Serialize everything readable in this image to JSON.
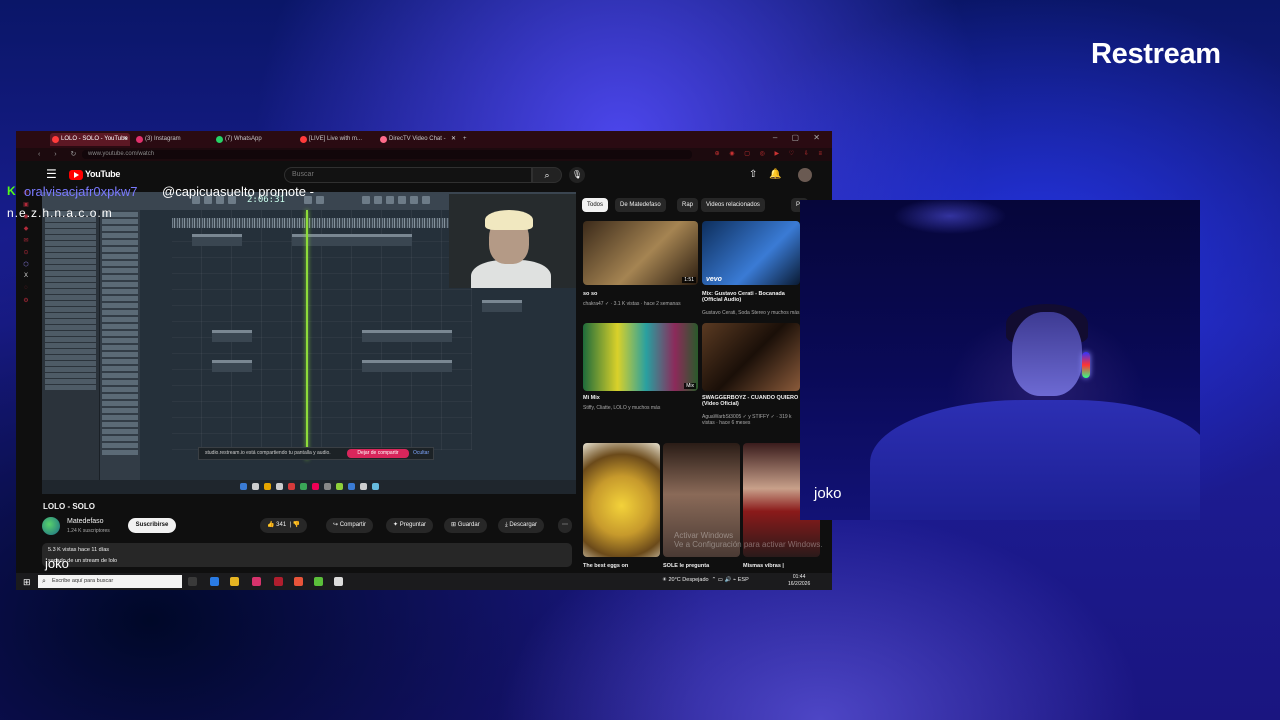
{
  "brand": {
    "logo_text": "Restream"
  },
  "browser": {
    "tabs": [
      {
        "label": "LOLO - SOLO - YouTube",
        "color": "#ff3b3b"
      },
      {
        "label": "(3) Instagram",
        "color": "#e1306c"
      },
      {
        "label": "(7) WhatsApp",
        "color": "#25d366"
      },
      {
        "label": "[LIVE] Live with m...",
        "color": "#ff3b3b"
      },
      {
        "label": "DirecTV Video Chat -",
        "color": "#ff6b8a"
      }
    ],
    "active_tab": 0,
    "url": "www.youtube.com/watch"
  },
  "youtube": {
    "logo_text": "YouTube",
    "search_placeholder": "Buscar",
    "video": {
      "title": "LOLO - SOLO",
      "channel": "Matedefaso",
      "subscribers": "1.24 K suscriptores",
      "subscribe_label": "Suscribirse",
      "likes": "341",
      "share_label": "Compartir",
      "ask_label": "Preguntar",
      "save_label": "Guardar",
      "download_label": "Descargar",
      "views_date": "5.3 K vistas  hace 11 días",
      "description": "sacado de un stream de lolo"
    },
    "player": {
      "time_display": "2:06:31",
      "share_notice": "studio.restream.io está compartiendo tu pantalla y audio.",
      "share_stop_label": "Dejar de compartir",
      "share_hide_label": "Ocultar"
    },
    "chips": [
      {
        "label": "Todos",
        "selected": true
      },
      {
        "label": "De Matedefaso",
        "selected": false
      },
      {
        "label": "Rap",
        "selected": false
      },
      {
        "label": "Videos relacionados",
        "selected": false
      },
      {
        "label": "Pa",
        "selected": false
      }
    ],
    "recommended": [
      {
        "title": "so so",
        "meta": "chakra47 ✓ · 3.1 K vistas · hace 2 semanas",
        "duration": "1:51",
        "color": "#6f5038"
      },
      {
        "title": "Mix: Gustavo Cerati - Bocanada (Official Audio)",
        "meta": "Gustavo Cerati, Soda Stereo y muchos más",
        "badge": "vevo",
        "color": "#1d4f8f"
      },
      {
        "title": "Mi Mix",
        "meta": "Stiffy, Cliatte, LOLO y muchos más",
        "duration": "Mix",
        "color": "#3a8a5a"
      },
      {
        "title": "SWAGGERBOYZ - CUANDO QUIERO (Video Oficial)",
        "meta": "AguaWarbSt3005 ✓ y STIFFY ✓ · 319 k vistas · hace 6 meses",
        "color": "#3a2418"
      },
      {
        "title": "The best eggs on",
        "meta": "",
        "color": "#c79a2c"
      },
      {
        "title": "SOLE le pregunta",
        "meta": "",
        "color": "#6b5045"
      },
      {
        "title": "Mismas vibras |",
        "meta": "",
        "color": "#5b2a2a"
      }
    ],
    "activate_windows": "Activar Windows\nVe a Configuración para activar Windows."
  },
  "windows_taskbar": {
    "search_placeholder": "Escribe aquí para buscar",
    "weather": "20°C  Despejado",
    "time": "01:44",
    "date": "16/2/2026"
  },
  "chat": {
    "username": "oralvisacjafr0xpkw7",
    "message": "@capicuasuelto promote -",
    "continuation": "n.e.z.h.n.a.c.o.m",
    "username_color": "#7a7aff",
    "platform_icon": "kick-icon"
  },
  "participants": {
    "screen_label": "joko",
    "camera_label": "joko"
  }
}
